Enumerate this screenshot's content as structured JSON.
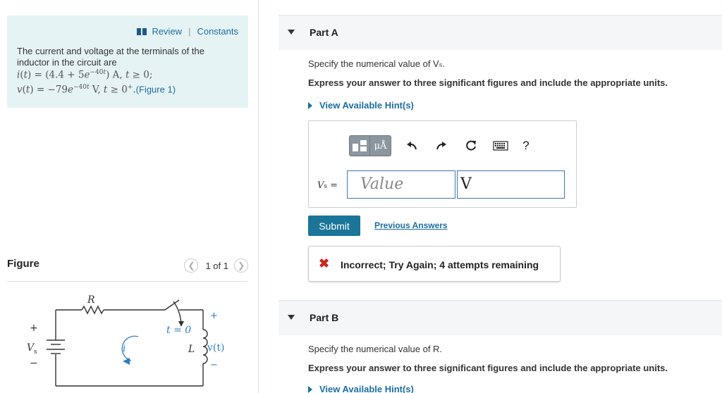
{
  "left": {
    "review_label": "Review",
    "separator": "|",
    "constants_label": "Constants",
    "intro_line1": "The current and voltage at the terminals of the",
    "intro_line2": "inductor in the circuit are",
    "current_eq": "i(t) = (4.4 + 5e^{−40t}) A, t ≥ 0;",
    "voltage_eq": "v(t) = −79e^{−40t} V, t ≥ 0+.",
    "figure_link": "(Figure 1)",
    "figure_title": "Figure",
    "pager_text": "1 of 1",
    "circuit": {
      "resistor_label": "R",
      "source_label": "V",
      "source_sub": "s",
      "plus": "+",
      "minus": "−",
      "current_label": "i",
      "switch_label": "t = 0",
      "inductor_label": "L",
      "voltage_label": "v(t)"
    }
  },
  "partA": {
    "title": "Part A",
    "question": "Specify the numerical value of V",
    "question_sub": "s",
    "question_end": ".",
    "instruction": "Express your answer to three significant figures and include the appropriate units.",
    "hint_label": "View Available Hint(s)",
    "toolbar": {
      "templates_icon": "templates-icon",
      "units_label": "μÅ",
      "undo_icon": "undo-icon",
      "redo_icon": "redo-icon",
      "reset_icon": "reset-icon",
      "keyboard_icon": "keyboard-icon",
      "help_label": "?"
    },
    "var_label": "V",
    "var_sub": "s",
    "var_eq": "=",
    "value_placeholder": "Value",
    "unit_value": "V",
    "submit_label": "Submit",
    "previous_answers_label": "Previous Answers",
    "feedback_icon": "✖",
    "feedback_text": "Incorrect; Try Again; 4 attempts remaining"
  },
  "partB": {
    "title": "Part B",
    "question": "Specify the numerical value of R.",
    "instruction": "Express your answer to three significant figures and include the appropriate units.",
    "hint_label": "View Available Hint(s)"
  },
  "colors": {
    "link": "#1b6ea3",
    "submit": "#1a7599",
    "panel": "#e6f3f5",
    "error": "#c8261f"
  }
}
